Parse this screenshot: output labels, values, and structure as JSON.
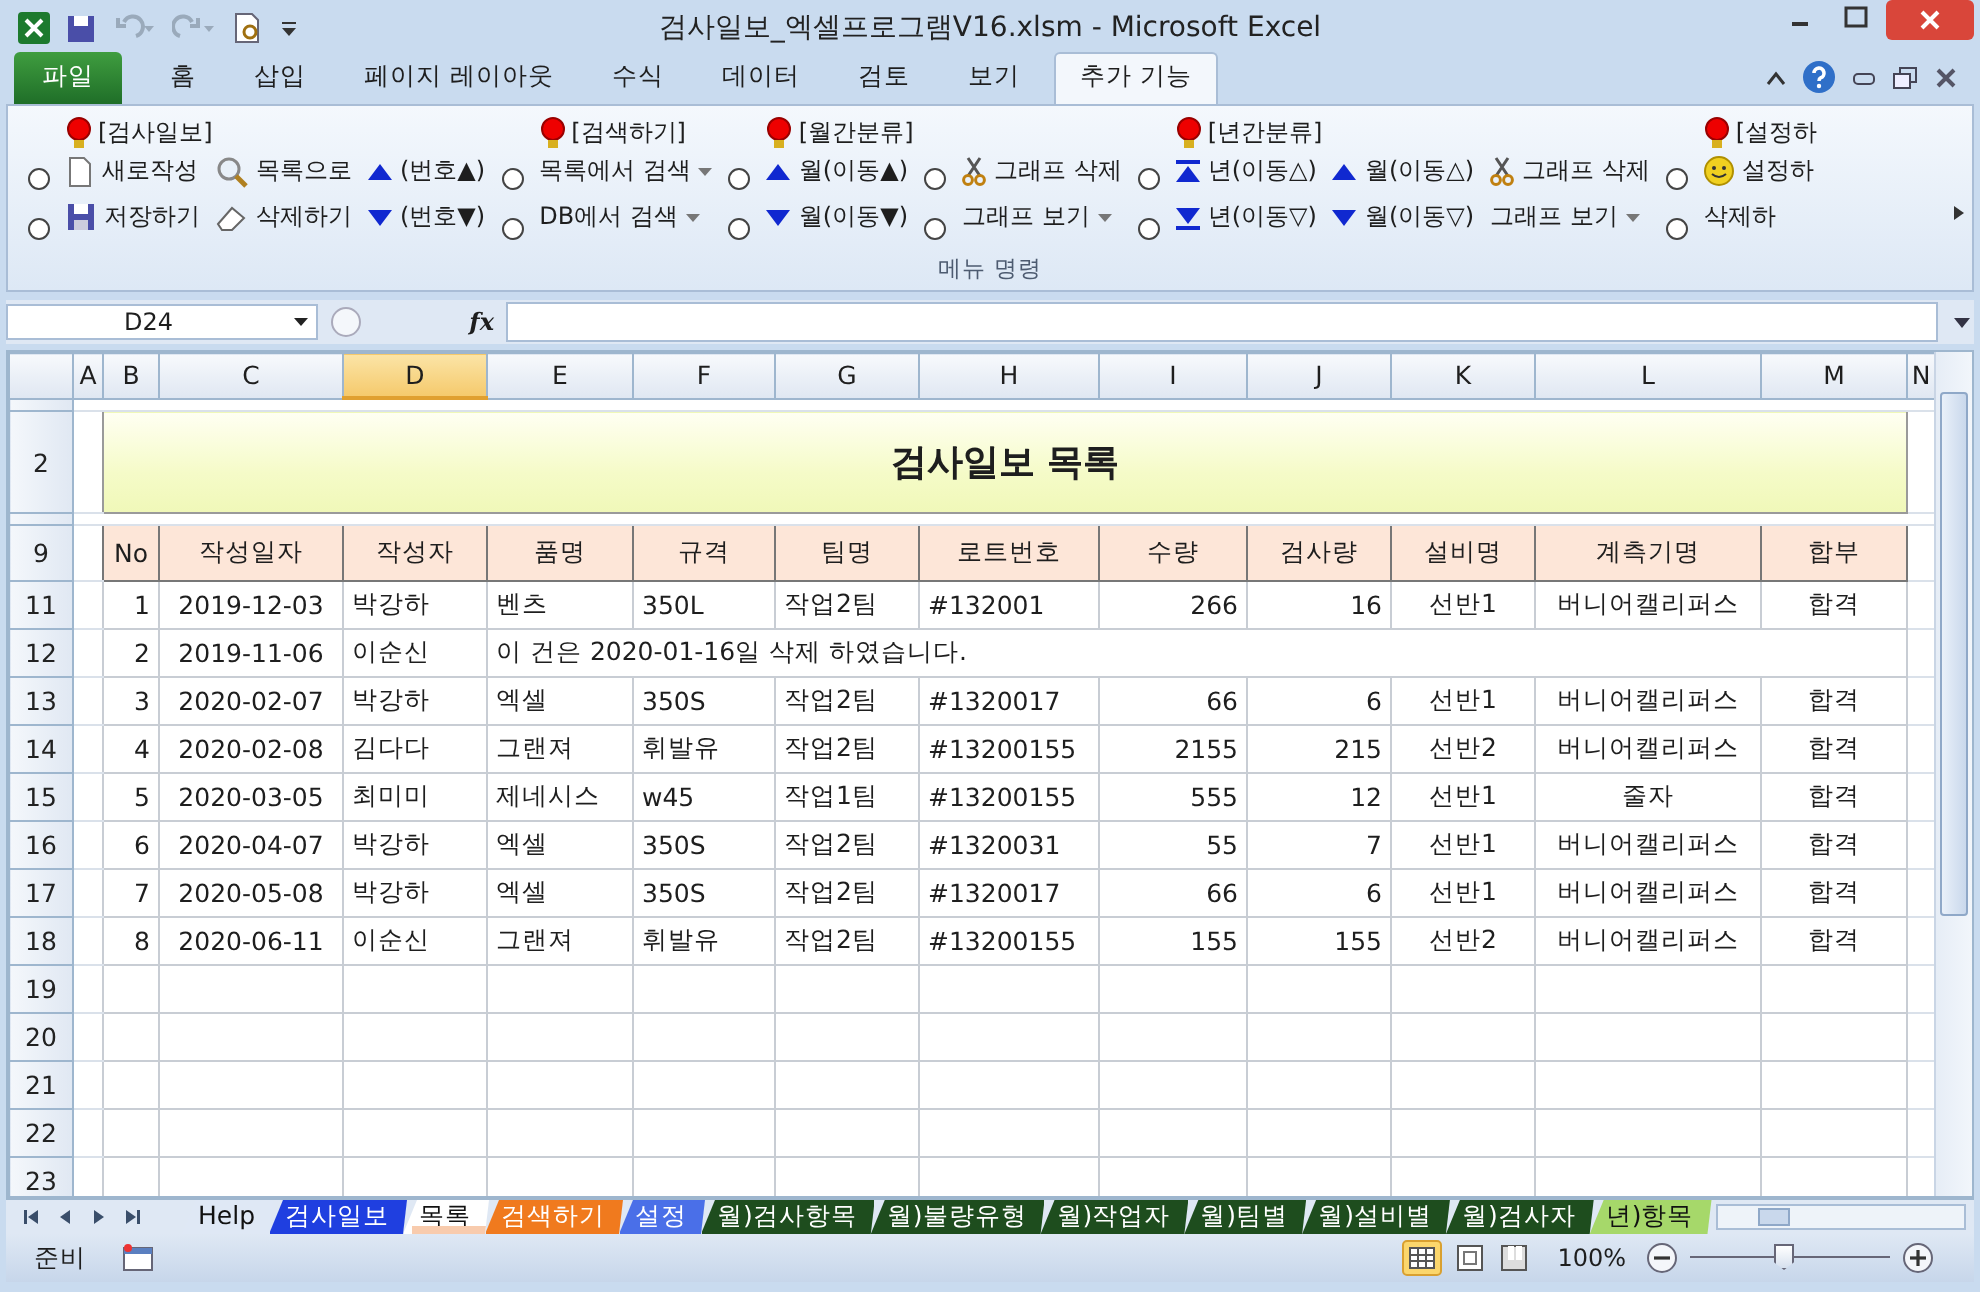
{
  "window": {
    "title": "검사일보_엑셀프로그램V16.xlsm  -  Microsoft Excel"
  },
  "ribbon_tabs": [
    {
      "label": "파일",
      "kind": "file",
      "selected": false
    },
    {
      "label": "홈",
      "kind": "tab",
      "selected": false
    },
    {
      "label": "삽입",
      "kind": "tab",
      "selected": false
    },
    {
      "label": "페이지 레이아웃",
      "kind": "tab",
      "selected": false
    },
    {
      "label": "수식",
      "kind": "tab",
      "selected": false
    },
    {
      "label": "데이터",
      "kind": "tab",
      "selected": false
    },
    {
      "label": "검토",
      "kind": "tab",
      "selected": false
    },
    {
      "label": "보기",
      "kind": "tab",
      "selected": false
    },
    {
      "label": "추가 기능",
      "kind": "tab",
      "selected": true
    }
  ],
  "ribbon_sections": [
    {
      "header": "[검사일보]",
      "radios": [
        {
          "selected": false
        },
        {
          "selected": false
        }
      ],
      "columns": [
        [
          {
            "label": "새로작성",
            "kind": "new"
          },
          {
            "label": "저장하기",
            "kind": "save"
          }
        ],
        [
          {
            "label": "목록으로",
            "kind": "search"
          },
          {
            "label": "삭제하기",
            "kind": "erase"
          }
        ],
        [
          {
            "label": "(번호▲)",
            "kind": "up"
          },
          {
            "label": "(번호▼)",
            "kind": "down"
          }
        ]
      ]
    },
    {
      "header": "[검색하기]",
      "radios": [
        {
          "selected": false
        },
        {
          "selected": false
        }
      ],
      "columns": [
        [
          {
            "label": "목록에서 검색",
            "kind": "dropdown"
          },
          {
            "label": "DB에서 검색",
            "kind": "dropdown"
          }
        ]
      ]
    },
    {
      "header": "[월간분류]",
      "radios": [
        {
          "selected": false
        },
        {
          "selected": false
        }
      ],
      "columns": [
        [
          {
            "label": "월(이동▲)",
            "kind": "up"
          },
          {
            "label": "월(이동▼)",
            "kind": "down"
          }
        ]
      ]
    },
    {
      "radios": [
        {
          "selected": false
        },
        {
          "selected": false
        }
      ],
      "columns": [
        [
          {
            "label": "그래프 삭제",
            "kind": "cut"
          },
          {
            "label": "그래프 보기",
            "kind": "dropdown"
          }
        ]
      ]
    },
    {
      "header": "[년간분류]",
      "radios": [
        {
          "selected": false
        },
        {
          "selected": false
        }
      ],
      "columns": [
        [
          {
            "label": "년(이동△)",
            "kind": "year-up"
          },
          {
            "label": "년(이동▽)",
            "kind": "year-down"
          }
        ],
        [
          {
            "label": "월(이동△)",
            "kind": "up"
          },
          {
            "label": "월(이동▽)",
            "kind": "down"
          }
        ],
        [
          {
            "label": "그래프 삭제",
            "kind": "cut"
          },
          {
            "label": "그래프 보기",
            "kind": "dropdown"
          }
        ]
      ]
    },
    {
      "header": "[설정하",
      "radios": [
        {
          "selected": false
        },
        {
          "selected": false
        }
      ],
      "columns": [
        [
          {
            "label": "설정하",
            "kind": "smile"
          },
          {
            "label": "삭제하",
            "kind": "plain"
          }
        ]
      ]
    }
  ],
  "ribbon_group_label": "메뉴 명령",
  "formula_bar": {
    "name_box": "D24",
    "function_button": "fx"
  },
  "sheet": {
    "columns": [
      {
        "label": "A",
        "selected": false
      },
      {
        "label": "B",
        "selected": false
      },
      {
        "label": "C",
        "selected": false
      },
      {
        "label": "D",
        "selected": true
      },
      {
        "label": "E",
        "selected": false
      },
      {
        "label": "F",
        "selected": false
      },
      {
        "label": "G",
        "selected": false
      },
      {
        "label": "H",
        "selected": false
      },
      {
        "label": "I",
        "selected": false
      },
      {
        "label": "J",
        "selected": false
      },
      {
        "label": "K",
        "selected": false
      },
      {
        "label": "L",
        "selected": false
      },
      {
        "label": "M",
        "selected": false
      },
      {
        "label": "N",
        "selected": false
      }
    ],
    "rows": [
      {
        "kind": "spacer"
      },
      {
        "row": "2",
        "kind": "title",
        "text": "검사일보 목록"
      },
      {
        "kind": "spacer"
      },
      {
        "row": "9",
        "kind": "header",
        "cells": [
          "No",
          "작성일자",
          "작성자",
          "품명",
          "규격",
          "팀명",
          "로트번호",
          "수량",
          "검사량",
          "설비명",
          "계측기명",
          "합부"
        ]
      },
      {
        "row": "11",
        "kind": "data",
        "cells": [
          "1",
          "2019-12-03",
          "박강하",
          "벤츠",
          "350L",
          "작업2팀",
          "#132001",
          "266",
          "16",
          "선반1",
          "버니어캘리퍼스",
          "합격"
        ]
      },
      {
        "row": "12",
        "kind": "note",
        "cells": [
          "2",
          "2019-11-06",
          "이순신"
        ],
        "note": "이 건은 2020-01-16일 삭제 하였습니다."
      },
      {
        "row": "13",
        "kind": "data",
        "cells": [
          "3",
          "2020-02-07",
          "박강하",
          "엑셀",
          "350S",
          "작업2팀",
          "#1320017",
          "66",
          "6",
          "선반1",
          "버니어캘리퍼스",
          "합격"
        ]
      },
      {
        "row": "14",
        "kind": "data",
        "cells": [
          "4",
          "2020-02-08",
          "김다다",
          "그랜져",
          "휘발유",
          "작업2팀",
          "#13200155",
          "2155",
          "215",
          "선반2",
          "버니어캘리퍼스",
          "합격"
        ]
      },
      {
        "row": "15",
        "kind": "data",
        "cells": [
          "5",
          "2020-03-05",
          "최미미",
          "제네시스",
          "w45",
          "작업1팀",
          "#13200155",
          "555",
          "12",
          "선반1",
          "줄자",
          "합격"
        ]
      },
      {
        "row": "16",
        "kind": "data",
        "cells": [
          "6",
          "2020-04-07",
          "박강하",
          "엑셀",
          "350S",
          "작업2팀",
          "#1320031",
          "55",
          "7",
          "선반1",
          "버니어캘리퍼스",
          "합격"
        ]
      },
      {
        "row": "17",
        "kind": "data",
        "cells": [
          "7",
          "2020-05-08",
          "박강하",
          "엑셀",
          "350S",
          "작업2팀",
          "#1320017",
          "66",
          "6",
          "선반1",
          "버니어캘리퍼스",
          "합격"
        ]
      },
      {
        "row": "18",
        "kind": "data",
        "cells": [
          "8",
          "2020-06-11",
          "이순신",
          "그랜져",
          "휘발유",
          "작업2팀",
          "#13200155",
          "155",
          "155",
          "선반2",
          "버니어캘리퍼스",
          "합격"
        ]
      },
      {
        "row": "19",
        "kind": "empty"
      },
      {
        "row": "20",
        "kind": "empty"
      },
      {
        "row": "21",
        "kind": "empty"
      },
      {
        "row": "22",
        "kind": "empty"
      },
      {
        "row": "23",
        "kind": "empty"
      }
    ]
  },
  "sheet_tabs": [
    {
      "label": "Help",
      "color": "#dfe8f5",
      "selected": false
    },
    {
      "label": "검사일보",
      "color": "#1f3fe0",
      "selected": false
    },
    {
      "label": "목록",
      "color": "#f8cbad",
      "selected": true
    },
    {
      "label": "검색하기",
      "color": "#f07a1e",
      "selected": false
    },
    {
      "label": "설정",
      "color": "#4a6fe8",
      "selected": false
    },
    {
      "label": "월)검사항목",
      "color": "#1e4d1e",
      "selected": false
    },
    {
      "label": "월)불량유형",
      "color": "#1e4d1e",
      "selected": false
    },
    {
      "label": "월)작업자",
      "color": "#1e4d1e",
      "selected": false
    },
    {
      "label": "월)팀별",
      "color": "#1e4d1e",
      "selected": false
    },
    {
      "label": "월)설비별",
      "color": "#1e4d1e",
      "selected": false
    },
    {
      "label": "월)검사자",
      "color": "#1e4d1e",
      "selected": false
    },
    {
      "label": "년)항목",
      "color": "#a6d86a",
      "selected": false
    }
  ],
  "status_bar": {
    "text": "준비",
    "zoom": "100%",
    "zoom_slider": {
      "level": 0.47
    }
  }
}
